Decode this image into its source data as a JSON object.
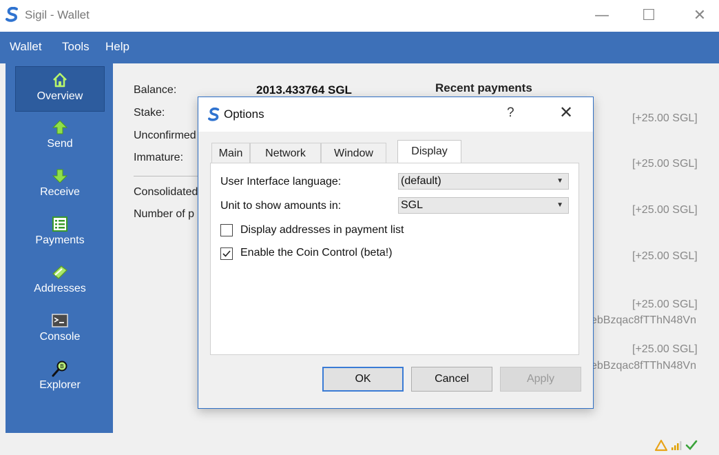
{
  "window": {
    "title": "Sigil - Wallet",
    "controls": {
      "minimize": "—",
      "maximize": "☐",
      "close": "✕"
    }
  },
  "menubar": {
    "items": [
      "Wallet",
      "Tools",
      "Help"
    ]
  },
  "sidebar": {
    "items": [
      {
        "label": "Overview",
        "icon": "home-icon",
        "active": true
      },
      {
        "label": "Send",
        "icon": "up-arrow-icon"
      },
      {
        "label": "Receive",
        "icon": "down-arrow-icon"
      },
      {
        "label": "Payments",
        "icon": "list-icon"
      },
      {
        "label": "Addresses",
        "icon": "tag-icon"
      },
      {
        "label": "Console",
        "icon": "terminal-icon"
      },
      {
        "label": "Explorer",
        "icon": "magnifier-icon"
      }
    ]
  },
  "overview": {
    "balance_label": "Balance:",
    "balance_value": "2013.433764 SGL",
    "stake_label": "Stake:",
    "unconfirmed_label": "Unconfirmed",
    "immature_label": "Immature:",
    "consolidated_label": "Consolidated",
    "number_label": "Number of p",
    "recent_title": "Recent payments",
    "payments": [
      {
        "amount": "[+25.00 SGL]",
        "address": ""
      },
      {
        "amount": "[+25.00 SGL]",
        "address": ""
      },
      {
        "amount": "[+25.00 SGL]",
        "address": ""
      },
      {
        "amount": "[+25.00 SGL]",
        "address": ""
      },
      {
        "amount": "[+25.00 SGL]",
        "address": "ebBzqac8fTThN48Vn"
      },
      {
        "amount": "[+25.00 SGL]",
        "address": "ebBzqac8fTThN48Vn"
      }
    ]
  },
  "dialog": {
    "title": "Options",
    "help": "?",
    "close": "✕",
    "tabs": [
      {
        "label": "Main"
      },
      {
        "label": "Network"
      },
      {
        "label": "Window"
      },
      {
        "label": "Display",
        "active": true
      }
    ],
    "display": {
      "language_label": "User Interface language:",
      "language_value": "(default)",
      "unit_label": "Unit to show amounts in:",
      "unit_value": "SGL",
      "addresses_checkbox_label": "Display addresses in payment list",
      "addresses_checked": false,
      "coin_control_label": "Enable the Coin Control (beta!)",
      "coin_control_checked": true
    },
    "buttons": {
      "ok": "OK",
      "cancel": "Cancel",
      "apply": "Apply"
    }
  },
  "statusbar": {
    "icons": [
      "warning-icon",
      "signal-icon",
      "synced-check-icon"
    ],
    "colors": {
      "warning": "#e8a317",
      "signal": "#e0a000",
      "check": "#3aa33a"
    }
  },
  "colors": {
    "accent": "#3d70b8",
    "sidebar_active": "#2d5c9e",
    "dialog_border": "#2f6fc4"
  }
}
